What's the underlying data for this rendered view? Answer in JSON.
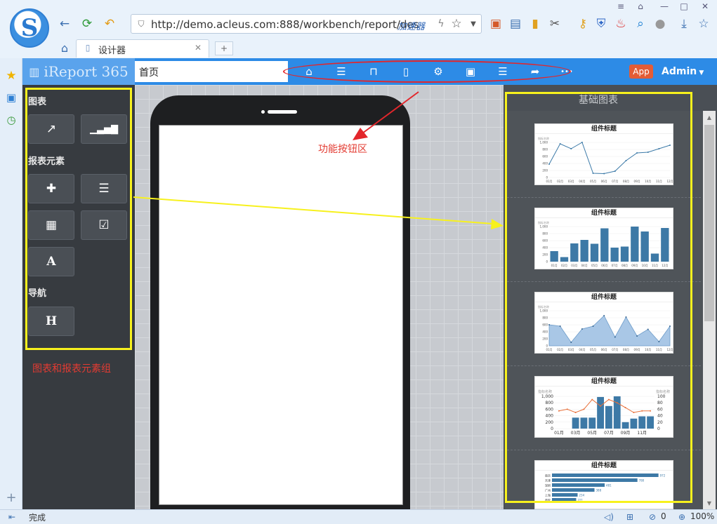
{
  "browser": {
    "address": "http://demo.acleus.com:888/workbench/report/des",
    "accelerator": "加速器",
    "tab_title": "设计器",
    "new_tab": "+"
  },
  "app": {
    "brand": "iReport 365",
    "page_name": "首页",
    "app_button": "App",
    "user_menu": "Admin",
    "more": "•••"
  },
  "palette": {
    "sections": [
      {
        "title": "图表"
      },
      {
        "title": "报表元素"
      },
      {
        "title": "导航"
      }
    ]
  },
  "right_panel": {
    "title": "基础图表",
    "chart_titles": [
      "组件标题",
      "组件标题",
      "组件标题",
      "组件标题",
      "组件标题"
    ]
  },
  "annotations": {
    "function_area": "功能按钮区",
    "element_groups": "图表和报表元素组"
  },
  "status": {
    "text": "完成",
    "blocked_count": "0",
    "zoom": "100%"
  },
  "chart_data": [
    {
      "type": "line",
      "title": "组件标题",
      "ylabel": "指标名称",
      "categories": [
        "01月",
        "02月",
        "03月",
        "04月",
        "05月",
        "06月",
        "07月",
        "08月",
        "09月",
        "10月",
        "11月",
        "12月"
      ],
      "values": [
        380,
        960,
        820,
        1000,
        120,
        110,
        180,
        480,
        700,
        720,
        820,
        920
      ],
      "ylim": [
        0,
        1000
      ],
      "y_ticks": [
        "1,000",
        "800",
        "600",
        "400",
        "200",
        "0"
      ]
    },
    {
      "type": "bar",
      "title": "组件标题",
      "ylabel": "指标名称",
      "categories": [
        "01月",
        "02月",
        "03月",
        "04月",
        "05月",
        "06月",
        "07月",
        "08月",
        "09月",
        "10月",
        "11月",
        "12月"
      ],
      "values": [
        300,
        130,
        520,
        620,
        510,
        950,
        400,
        430,
        1000,
        860,
        230,
        960
      ],
      "ylim": [
        0,
        1000
      ],
      "y_ticks": [
        "1,000",
        "800",
        "600",
        "400",
        "200",
        "0"
      ]
    },
    {
      "type": "area",
      "title": "组件标题",
      "ylabel": "指标名称",
      "categories": [
        "01月",
        "02月",
        "03月",
        "04月",
        "05月",
        "06月",
        "07月",
        "08月",
        "09月",
        "10月",
        "11月",
        "12月"
      ],
      "values": [
        600,
        560,
        100,
        480,
        560,
        860,
        250,
        820,
        280,
        470,
        120,
        560
      ],
      "ylim": [
        0,
        1000
      ],
      "y_ticks": [
        "1,000",
        "800",
        "600",
        "400",
        "200",
        "0"
      ]
    },
    {
      "type": "bar",
      "title": "组件标题",
      "ylabel": "指标名称",
      "y2label": "指标名称",
      "categories": [
        "01月",
        "02月",
        "03月",
        "04月",
        "05月",
        "06月",
        "07月",
        "08月",
        "09月",
        "10月",
        "11月",
        "12月"
      ],
      "series": [
        {
          "values": [
            0,
            0,
            340,
            340,
            340,
            980,
            700,
            1000,
            200,
            310,
            380,
            380
          ]
        },
        {
          "type": "line",
          "values": [
            55,
            60,
            50,
            60,
            90,
            70,
            90,
            80,
            65,
            50,
            55,
            55
          ]
        }
      ],
      "ylim": [
        0,
        1000
      ],
      "y2lim": [
        0,
        100
      ],
      "y_ticks": [
        "1,000",
        "800",
        "600",
        "400",
        "200",
        "0"
      ],
      "y2_ticks": [
        "100",
        "80",
        "60",
        "40",
        "20",
        "0"
      ],
      "x_ticks": [
        "01月",
        "03月",
        "05月",
        "07月",
        "09月",
        "11月"
      ]
    },
    {
      "type": "bar",
      "orientation": "horizontal",
      "title": "组件标题",
      "categories": [
        "南京",
        "天津",
        "深圳",
        "广州",
        "上海",
        "西安"
      ],
      "values": [
        972,
        780,
        481,
        388,
        234,
        221
      ],
      "labels": [
        "972",
        "780",
        "481",
        "388",
        "234",
        "221"
      ]
    }
  ]
}
